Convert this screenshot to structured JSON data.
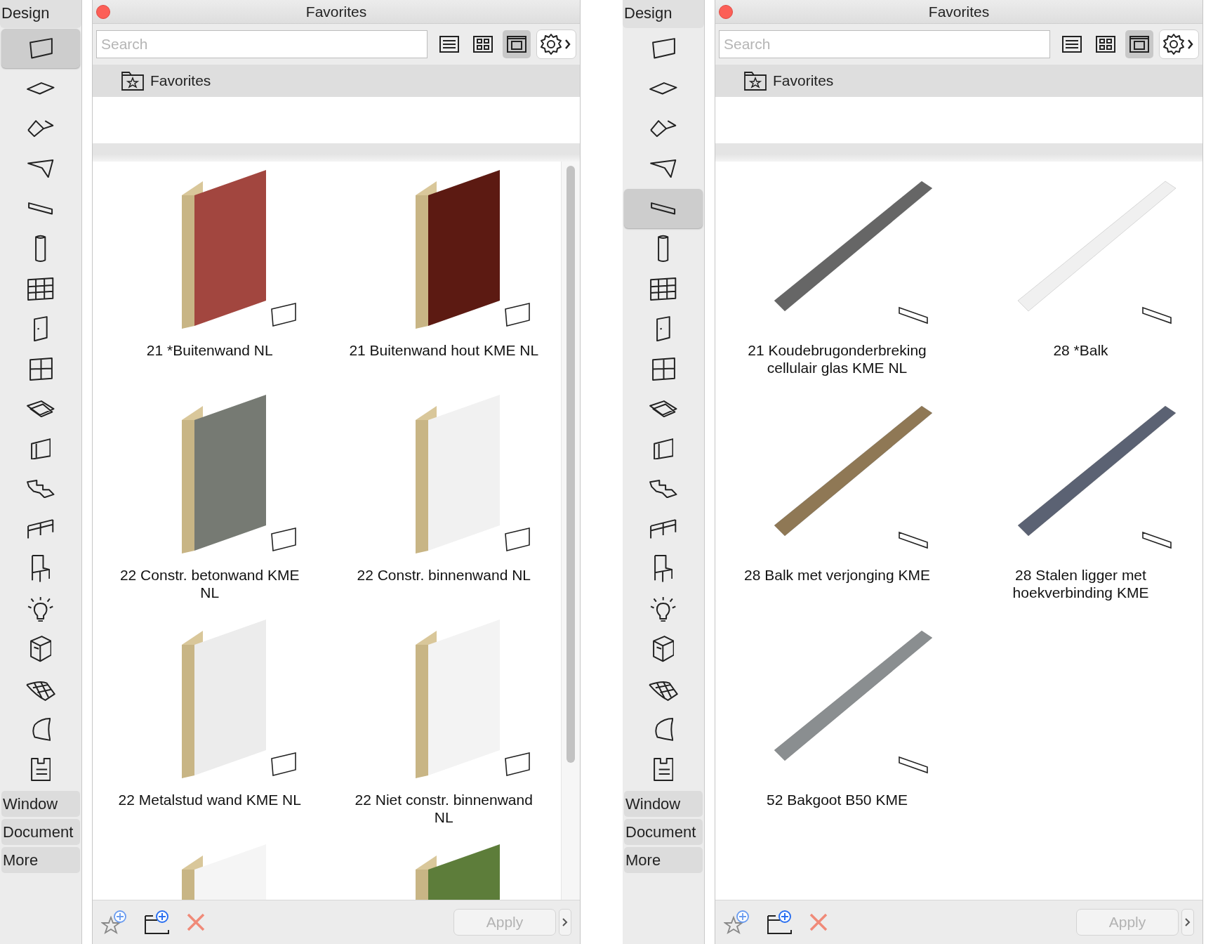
{
  "workspaces": [
    {
      "toolbox": {
        "title": "Design",
        "tools": [
          {
            "selected": true
          },
          {
            "selected": false
          },
          {
            "selected": false
          },
          {
            "selected": false
          },
          {
            "selected": false
          },
          {
            "selected": false
          },
          {
            "selected": false
          },
          {
            "selected": false
          },
          {
            "selected": false
          },
          {
            "selected": false
          },
          {
            "selected": false
          },
          {
            "selected": false
          },
          {
            "selected": false
          },
          {
            "selected": false
          },
          {
            "selected": false
          },
          {
            "selected": false
          },
          {
            "selected": false
          },
          {
            "selected": false
          },
          {
            "selected": false
          }
        ],
        "sections": [
          {
            "label": "Window"
          },
          {
            "label": "Document"
          },
          {
            "label": "More"
          }
        ]
      },
      "panel": {
        "title": "Favorites",
        "search": {
          "placeholder": "Search"
        },
        "view_modes": [
          {
            "selected": false
          },
          {
            "selected": false
          },
          {
            "selected": true
          }
        ],
        "folder": "Favorites",
        "scrollable": true,
        "items": [
          {
            "label": "21 *Buitenwand NL",
            "kind": "wall",
            "color": "#a2463f"
          },
          {
            "label": "21 Buitenwand hout KME NL",
            "kind": "wall",
            "color": "#5c1a12"
          },
          {
            "label": "22 Constr. betonwand KME NL",
            "kind": "wall",
            "color": "#767a73"
          },
          {
            "label": "22 Constr. binnenwand NL",
            "kind": "wall",
            "color": "#f1f1f1"
          },
          {
            "label": "22 Metalstud wand KME NL",
            "kind": "wall",
            "color": "#ececec"
          },
          {
            "label": "22 Niet constr. binnenwand NL",
            "kind": "wall",
            "color": "#f3f3f3"
          },
          {
            "kind": "wall",
            "color": "#f5f5f5"
          },
          {
            "kind": "wall",
            "color": "#5d7d3a"
          }
        ],
        "apply": {
          "label": "Apply",
          "disabled": true
        }
      }
    },
    {
      "toolbox": {
        "title": "Design",
        "tools": [
          {
            "selected": false
          },
          {
            "selected": false
          },
          {
            "selected": false
          },
          {
            "selected": false
          },
          {
            "selected": true
          },
          {
            "selected": false
          },
          {
            "selected": false
          },
          {
            "selected": false
          },
          {
            "selected": false
          },
          {
            "selected": false
          },
          {
            "selected": false
          },
          {
            "selected": false
          },
          {
            "selected": false
          },
          {
            "selected": false
          },
          {
            "selected": false
          },
          {
            "selected": false
          },
          {
            "selected": false
          },
          {
            "selected": false
          },
          {
            "selected": false
          }
        ],
        "sections": [
          {
            "label": "Window"
          },
          {
            "label": "Document"
          },
          {
            "label": "More"
          }
        ]
      },
      "panel": {
        "title": "Favorites",
        "search": {
          "placeholder": "Search"
        },
        "view_modes": [
          {
            "selected": false
          },
          {
            "selected": false
          },
          {
            "selected": true
          }
        ],
        "folder": "Favorites",
        "scrollable": false,
        "items": [
          {
            "label": "21 Koudebrugonderbreking cellulair glas KME NL",
            "kind": "beam",
            "color": "#666666"
          },
          {
            "label": "28 *Balk",
            "kind": "beam",
            "color": "#f0f0f0"
          },
          {
            "label": "28 Balk met verjonging KME",
            "kind": "beam",
            "color": "#8f7855"
          },
          {
            "label": "28 Stalen ligger met hoekverbinding KME",
            "kind": "beam",
            "color": "#5b6273"
          },
          {
            "label": "52 Bakgoot B50 KME",
            "kind": "beam",
            "color": "#8a8e90"
          }
        ],
        "apply": {
          "label": "Apply",
          "disabled": true
        }
      }
    }
  ]
}
